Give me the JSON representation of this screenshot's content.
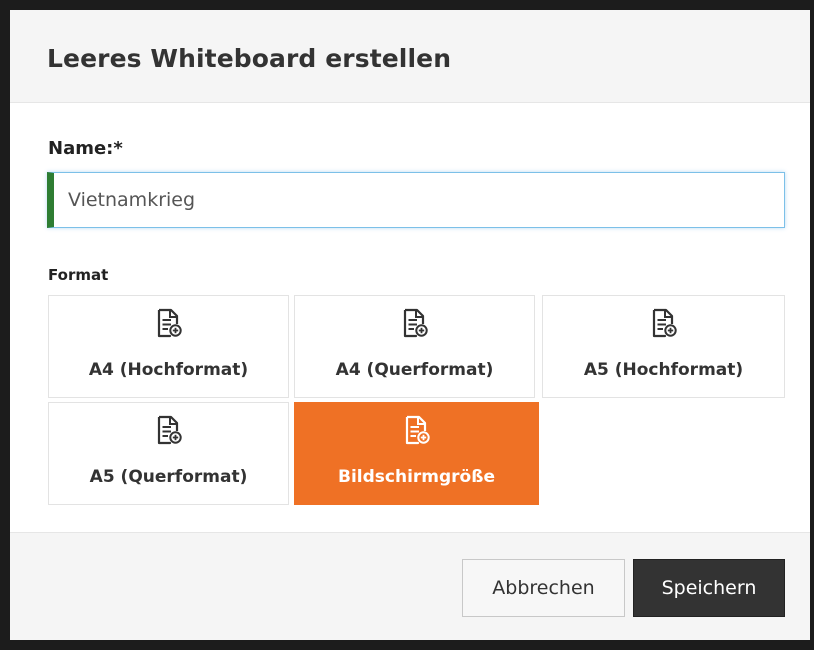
{
  "dialog": {
    "title": "Leeres Whiteboard erstellen"
  },
  "form": {
    "name_label": "Name:*",
    "name_value": "Vietnamkrieg",
    "format_label": "Format"
  },
  "formats": [
    {
      "label": "A4 (Hochformat)",
      "icon": "document-add-icon",
      "selected": false
    },
    {
      "label": "A4 (Querformat)",
      "icon": "document-add-icon",
      "selected": false
    },
    {
      "label": "A5 (Hochformat)",
      "icon": "document-add-icon",
      "selected": false
    },
    {
      "label": "A5 (Querformat)",
      "icon": "document-add-icon",
      "selected": false
    },
    {
      "label": "Bildschirmgröße",
      "icon": "document-add-icon",
      "selected": true
    }
  ],
  "footer": {
    "cancel_label": "Abbrechen",
    "save_label": "Speichern"
  },
  "colors": {
    "accent_selected": "#ef7125",
    "input_valid_marker": "#2e7d32",
    "save_button": "#333333"
  }
}
